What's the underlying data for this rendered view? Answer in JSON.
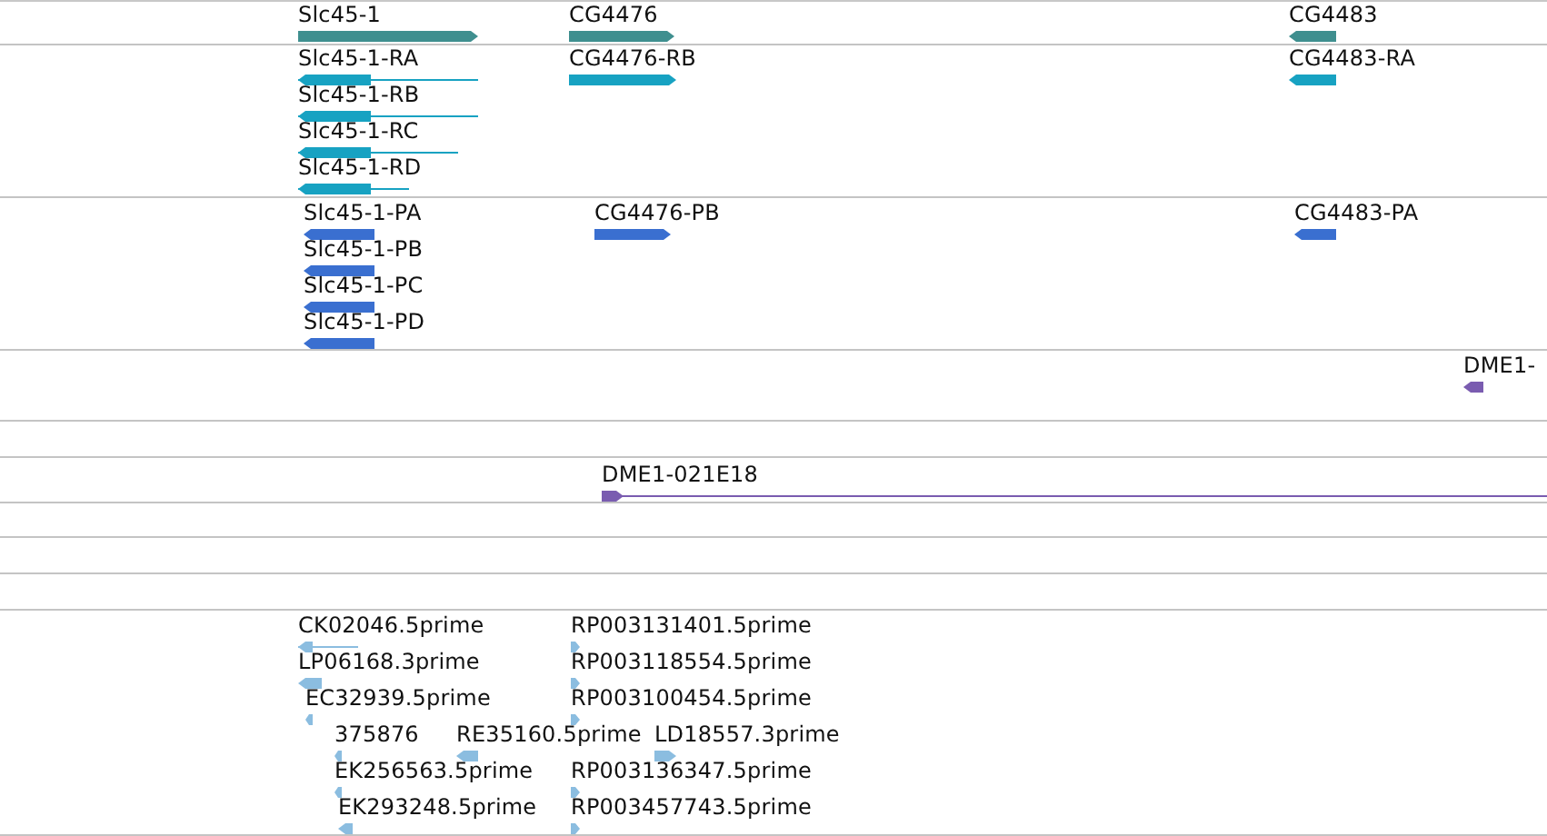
{
  "tracks": [
    {
      "color": "#3f8f8f",
      "features": [
        {
          "label": "Slc45-1",
          "reverse": false
        },
        {
          "label": "CG4476",
          "reverse": false
        },
        {
          "label": "CG4483",
          "reverse": true
        }
      ]
    },
    {
      "color": "#17a2c2",
      "features": [
        {
          "label": "Slc45-1-RA",
          "reverse": true
        },
        {
          "label": "Slc45-1-RB",
          "reverse": true
        },
        {
          "label": "Slc45-1-RC",
          "reverse": true
        },
        {
          "label": "Slc45-1-RD",
          "reverse": true
        },
        {
          "label": "CG4476-RB",
          "reverse": false
        },
        {
          "label": "CG4483-RA",
          "reverse": true
        }
      ]
    },
    {
      "color": "#3a6fd0",
      "features": [
        {
          "label": "Slc45-1-PA",
          "reverse": true
        },
        {
          "label": "Slc45-1-PB",
          "reverse": true
        },
        {
          "label": "Slc45-1-PC",
          "reverse": true
        },
        {
          "label": "Slc45-1-PD",
          "reverse": true
        },
        {
          "label": "CG4476-PB",
          "reverse": false
        },
        {
          "label": "CG4483-PA",
          "reverse": true
        }
      ]
    },
    {
      "color": "#7a5cb0",
      "features": [
        {
          "label": "DME1-",
          "reverse": true
        }
      ]
    },
    {
      "color": "#7a5cb0",
      "features": [
        {
          "label": "DME1-021E18",
          "reverse": false
        }
      ]
    },
    {
      "color": "#8bbde0",
      "features": [
        {
          "label": "CK02046.5prime",
          "reverse": true
        },
        {
          "label": "RP003131401.5prime",
          "reverse": false
        },
        {
          "label": "LP06168.3prime",
          "reverse": true
        },
        {
          "label": "RP003118554.5prime",
          "reverse": false
        },
        {
          "label": "EC32939.5prime",
          "reverse": true
        },
        {
          "label": "RP003100454.5prime",
          "reverse": false
        },
        {
          "label": "375876",
          "reverse": true
        },
        {
          "label": "RE35160.5prime",
          "reverse": true
        },
        {
          "label": "LD18557.3prime",
          "reverse": false
        },
        {
          "label": "EK256563.5prime",
          "reverse": true
        },
        {
          "label": "RP003136347.5prime",
          "reverse": false
        },
        {
          "label": "EK293248.5prime",
          "reverse": true
        },
        {
          "label": "RP003457743.5prime",
          "reverse": false
        }
      ]
    }
  ]
}
